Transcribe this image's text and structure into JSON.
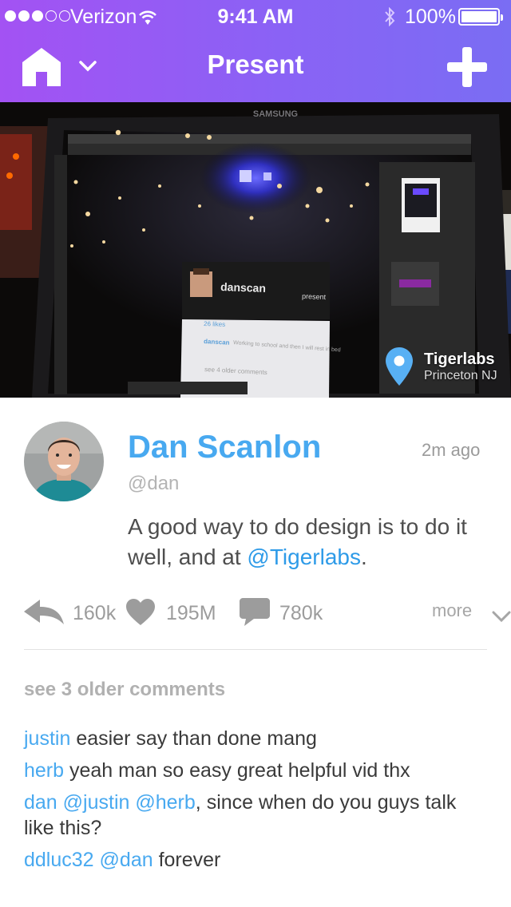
{
  "status_bar": {
    "carrier": "Verizon",
    "signal_bars_filled": 3,
    "signal_bars_total": 5,
    "time": "9:41 AM",
    "battery": "100%",
    "battery_level": 1.0
  },
  "nav": {
    "title": "Present",
    "left_icon": "home-icon",
    "add_icon": "plus-icon"
  },
  "photo": {
    "brand_text": "SAMSUNG",
    "overlay_username": "danscan",
    "overlay_present": "present",
    "overlay_likes": "26 likes",
    "overlay_comment_user": "danscan",
    "overlay_comment_text": "Working to school and then I will rest in bed",
    "overlay_older": "see 4 older comments",
    "location_name": "Tigerlabs",
    "location_city": "Princeton NJ"
  },
  "post": {
    "author_name": "Dan Scanlon",
    "author_handle": "@dan",
    "time_ago": "2m ago",
    "text_before": "A good way to do design is to do it well, and at ",
    "mention": "@Tigerlabs",
    "text_after": "."
  },
  "actions": {
    "reposts": "160k",
    "likes": "195M",
    "comments": "780k",
    "more": "more"
  },
  "comments": {
    "older_label": "see 3 older comments",
    "items": [
      {
        "user": "justin",
        "text": " easier say than done mang"
      },
      {
        "user": "herb",
        "text": " yeah man so easy great helpful vid thx"
      },
      {
        "user": "dan",
        "mention1": "@justin",
        "mention2": "@herb",
        "text": ", since when do you guys talk like this?"
      },
      {
        "user": "ddluc32",
        "mention1": "@dan",
        "text": " forever"
      }
    ]
  },
  "colors": {
    "header_start": "#a352f3",
    "header_end": "#7a6df3",
    "accent_blue": "#48a9f0",
    "icon_gray": "#9c9c9c"
  }
}
